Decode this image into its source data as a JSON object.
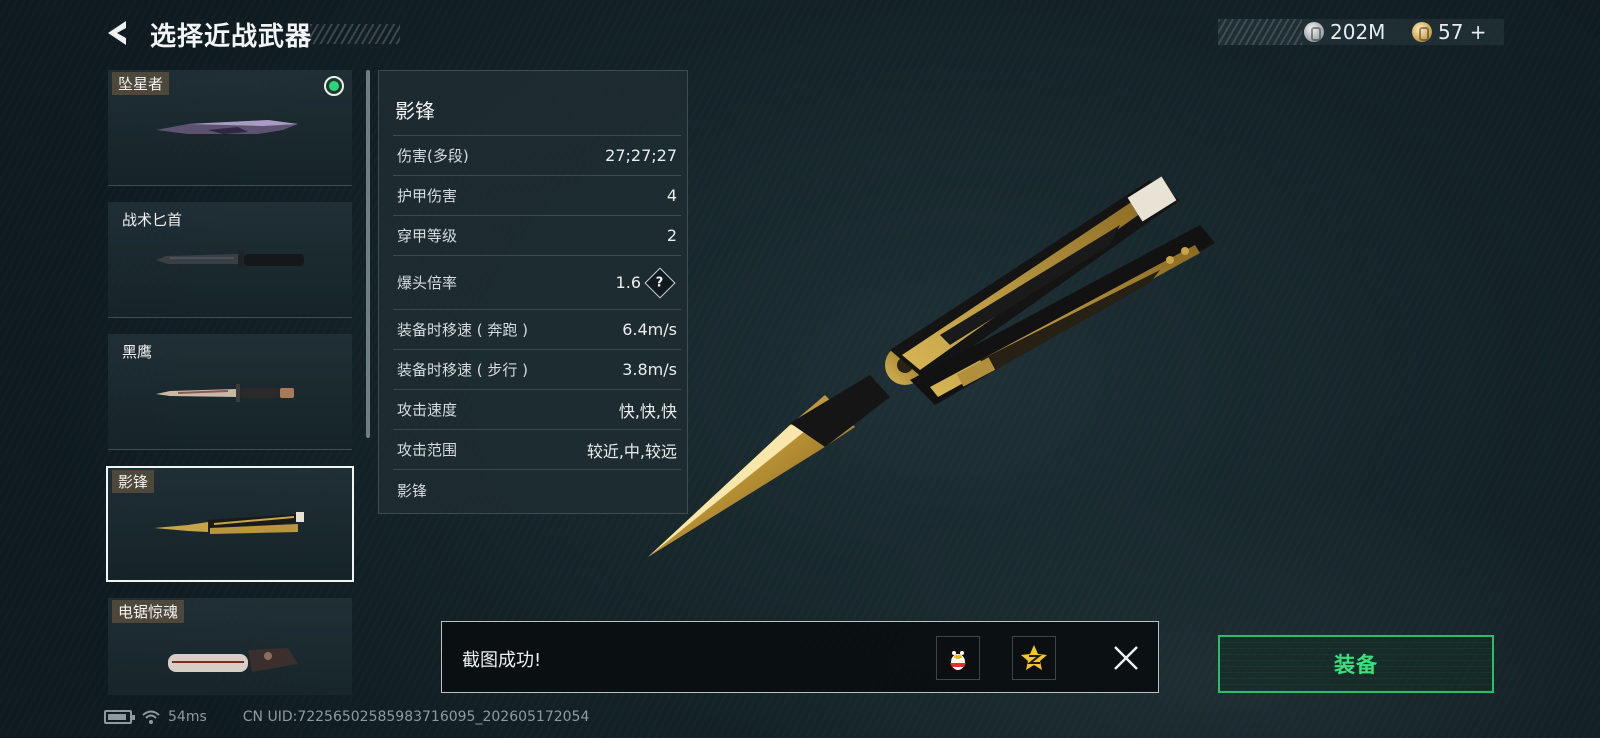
{
  "header": {
    "title": "选择近战武器",
    "currency": [
      {
        "icon": "silver-coin-icon",
        "value": "202M"
      },
      {
        "icon": "gold-coin-icon",
        "value": "57 +"
      }
    ]
  },
  "weapon_list": {
    "items": [
      {
        "name": "坠星者",
        "equipped": true,
        "selected": false
      },
      {
        "name": "战术匕首",
        "equipped": false,
        "selected": false
      },
      {
        "name": "黑鹰",
        "equipped": false,
        "selected": false
      },
      {
        "name": "影锋",
        "equipped": false,
        "selected": true
      },
      {
        "name": "电锯惊魂",
        "equipped": false,
        "selected": false
      }
    ]
  },
  "stats": {
    "title": "影锋",
    "rows": [
      {
        "label": "伤害(多段)",
        "value": "27;27;27"
      },
      {
        "label": "护甲伤害",
        "value": "4"
      },
      {
        "label": "穿甲等级",
        "value": "2"
      },
      {
        "label": "爆头倍率",
        "value": "1.6",
        "help": "?"
      },
      {
        "label": "装备时移速 ( 奔跑 )",
        "value": "6.4m/s"
      },
      {
        "label": "装备时移速 ( 步行 )",
        "value": "3.8m/s"
      },
      {
        "label": "攻击速度",
        "value": "快,快,快"
      },
      {
        "label": "攻击范围",
        "value": "较近,中,较远"
      }
    ],
    "footer": "影锋"
  },
  "toast": {
    "message": "截图成功!"
  },
  "equip_button": {
    "label": "装备"
  },
  "status_bar": {
    "latency": "54ms",
    "uid": "CN UID:72256502585983716095_202605172054"
  },
  "colors": {
    "accent_green": "#39e07d",
    "equipped_dot": "#2cd57a",
    "selection_border": "#f1f4f5"
  }
}
